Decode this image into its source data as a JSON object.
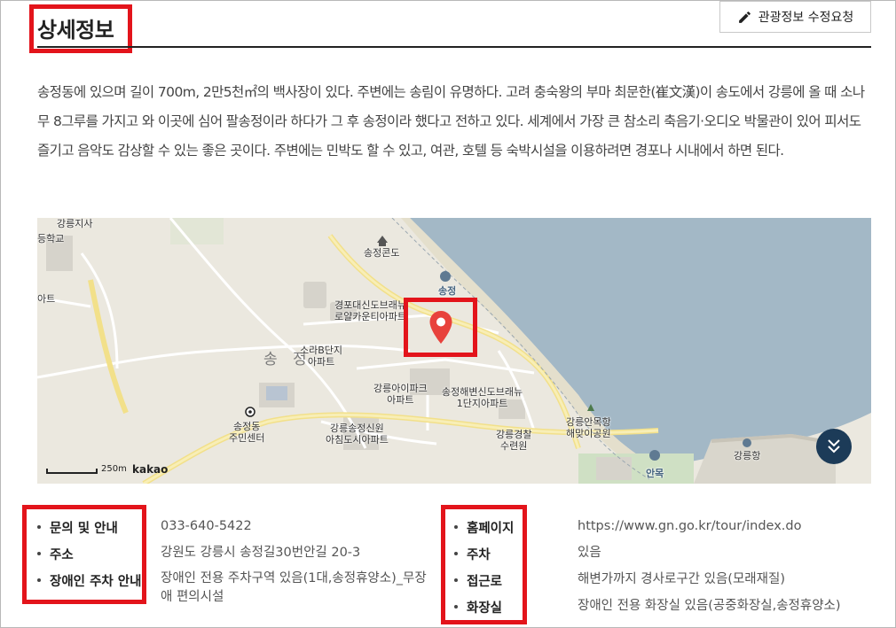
{
  "header": {
    "title": "상세정보",
    "edit_button_label": "관광정보 수정요청"
  },
  "description": "송정동에 있으며 길이 700m, 2만5천㎡의 백사장이 있다. 주변에는 송림이 유명하다. 고려 충숙왕의 부마 최문한(崔文漢)이 송도에서 강릉에 올 때 소나무 8그루를 가지고 와 이곳에 심어 팔송정이라 하다가 그 후 송정이라 했다고 전하고 있다. 세계에서 가장 큰 참소리 축음기·오디오 박물관이 있어 피서도 즐기고 음악도 감상할 수 있는 좋은 곳이다. 주변에는 민박도 할 수 있고, 여관, 호텔 등 숙박시설을 이용하려면 경포나 시내에서 하면 된다.",
  "map": {
    "labels": {
      "gangneung_jisa": "강릉지사",
      "school": "등학교",
      "apt_left": "아트",
      "songjeong_condo": "송정콘도",
      "gyeongpo_apt": "경포대신도브래뉴\n로얄카운티아파트",
      "sora_apt": "소라B단지\n아파트",
      "ipark_apt": "강릉아이파크\n아파트",
      "haebyeon_apt": "송정해변신도브래뉴\n1단지아파트",
      "center": "송정동\n주민센터",
      "sinwon_apt": "강릉송정신원\n아침도시아파트",
      "police": "강릉경찰\n수련원",
      "anmok_park": "강릉안목항\n해맞이공원",
      "gangneung_port": "강릉항",
      "songjeong_beach": "송정",
      "anmok": "안목",
      "watermark": "송 정"
    },
    "scale_label": "250m",
    "provider": "kakao",
    "colors": {
      "sea": "#a3b8c6",
      "land": "#ebe8df",
      "road": "#f6e9a4",
      "marker": "#e8423c",
      "highlight": "#e3141b"
    }
  },
  "info_left": [
    {
      "label": "문의 및 안내",
      "value": "033-640-5422"
    },
    {
      "label": "주소",
      "value": "강원도 강릉시 송정길30번안길 20-3"
    },
    {
      "label": "장애인 주차 안내",
      "value": "장애인 전용 주차구역 있음(1대,송정휴양소)_무장애 편의시설"
    }
  ],
  "info_right": [
    {
      "label": "홈페이지",
      "value": "https://www.gn.go.kr/tour/index.do"
    },
    {
      "label": "주차",
      "value": "있음"
    },
    {
      "label": "접근로",
      "value": "해변가까지 경사로구간 있음(모래재질)"
    },
    {
      "label": "화장실",
      "value": "장애인 전용 화장실 있음(공중화장실,송정휴양소)"
    }
  ]
}
